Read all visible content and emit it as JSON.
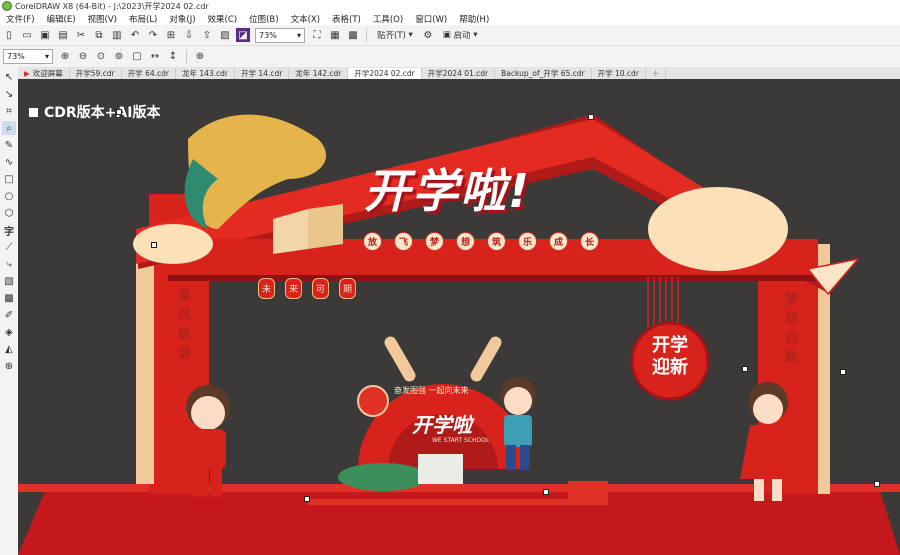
{
  "window": {
    "title": "CorelDRAW X8 (64-Bit) - J:\\2023\\开学2024 02.cdr"
  },
  "menu": [
    "文件(F)",
    "编辑(E)",
    "视图(V)",
    "布局(L)",
    "对象(J)",
    "效果(C)",
    "位图(B)",
    "文本(X)",
    "表格(T)",
    "工具(O)",
    "窗口(W)",
    "帮助(H)"
  ],
  "toolbar": {
    "zoom": "73%",
    "snap_label": "贴齐(T)",
    "launch_label": "启动"
  },
  "propbar": {
    "zoom": "73%"
  },
  "tabs": [
    "欢迎屏幕",
    "开学59.cdr",
    "开学 64.cdr",
    "龙年 143.cdr",
    "开学 14.cdr",
    "龙年 142.cdr",
    "开学2024 02.cdr",
    "开学2024 01.cdr",
    "Backup_of_开学 65.cdr",
    "开学 10.cdr"
  ],
  "active_tab": 6,
  "design": {
    "watermark": "CDR版本+AI版本",
    "headline": "开学啦!",
    "subtitle_chars": [
      "放",
      "飞",
      "梦",
      "想",
      "筑",
      "乐",
      "成",
      "长"
    ],
    "lanterns": [
      "未",
      "来",
      "可",
      "期"
    ],
    "left_banner": [
      "乘",
      "风",
      "破",
      "浪"
    ],
    "right_banner": [
      "梦",
      "想",
      "启",
      "航"
    ],
    "circle_badge": [
      "开学",
      "迎新"
    ],
    "center_arc": "奋发图强 一起向未来",
    "center_title": "开学啦",
    "center_sub": "WE START SCHOOL"
  },
  "colors": {
    "canvas": "#3b3a39",
    "red": "#d8221c",
    "dark_red": "#a3141a",
    "cream": "#fbe5c8",
    "gold": "#e2b774"
  }
}
